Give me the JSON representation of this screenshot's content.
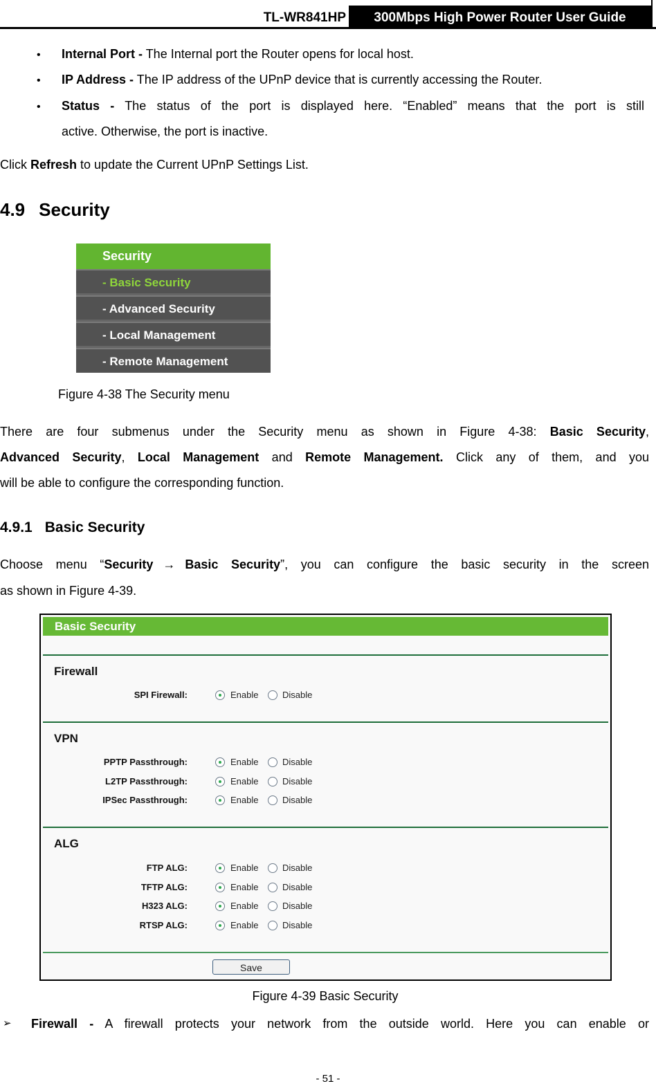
{
  "header": {
    "model": "TL-WR841HP",
    "guide_title": "300Mbps High Power Router User Guide"
  },
  "intro_bullets": [
    {
      "term": "Internal Port -",
      "text": " The Internal port the Router opens for local host."
    },
    {
      "term": "IP Address -",
      "text": " The IP address of the UPnP device that is currently accessing the Router."
    },
    {
      "term": "Status -",
      "text": " The status of the port is displayed here. “Enabled” means that the port is still",
      "text2": "active. Otherwise, the port is inactive."
    }
  ],
  "refresh_para": {
    "pre": "Click ",
    "bold": "Refresh",
    "post": " to update the Current UPnP Settings List."
  },
  "section": {
    "number": "4.9",
    "title": "Security"
  },
  "security_menu": {
    "header": "Security",
    "items": [
      {
        "label": "- Basic Security",
        "active": true
      },
      {
        "label": "- Advanced Security",
        "active": false
      },
      {
        "label": "- Local Management",
        "active": false
      },
      {
        "label": "- Remote Management",
        "active": false
      }
    ]
  },
  "figure38_caption": "Figure 4-38 The Security menu",
  "submenus_para": {
    "l1_pre": "There are four submenus under the Security menu as shown in Figure 4-38: ",
    "l1_bold": "Basic Security",
    "l1_post": ",",
    "l2_b1": "Advanced Security",
    "l2_sep": ", ",
    "l2_b2": "Local Management",
    "l2_and": " and ",
    "l2_b3": "Remote Management.",
    "l2_post": " Click any of them, and you",
    "l3": "will be able to configure the corresponding function."
  },
  "subsection": {
    "number": "4.9.1",
    "title": "Basic Security"
  },
  "choose_para": {
    "pre": "Choose menu “",
    "b1": "Security",
    "arrow": "→",
    "b2": "Basic Security",
    "post": "”, you can configure the basic security in the screen",
    "l2": "as shown in Figure 4-39."
  },
  "basic_security_panel": {
    "title": "Basic Security",
    "enable_label": "Enable",
    "disable_label": "Disable",
    "sections": [
      {
        "name": "Firewall",
        "rows": [
          {
            "label": "SPI Firewall:",
            "value": "Enable"
          }
        ]
      },
      {
        "name": "VPN",
        "rows": [
          {
            "label": "PPTP Passthrough:",
            "value": "Enable"
          },
          {
            "label": "L2TP Passthrough:",
            "value": "Enable"
          },
          {
            "label": "IPSec Passthrough:",
            "value": "Enable"
          }
        ]
      },
      {
        "name": "ALG",
        "rows": [
          {
            "label": "FTP ALG:",
            "value": "Enable"
          },
          {
            "label": "TFTP ALG:",
            "value": "Enable"
          },
          {
            "label": "H323 ALG:",
            "value": "Enable"
          },
          {
            "label": "RTSP ALG:",
            "value": "Enable"
          }
        ]
      }
    ],
    "save_label": "Save"
  },
  "figure39_caption": "Figure 4-39 Basic Security",
  "firewall_bullet": {
    "marker": "➢",
    "term": "Firewall -",
    "text": " A firewall protects your network from the outside world. Here you can enable or"
  },
  "page_number": "- 51 -"
}
